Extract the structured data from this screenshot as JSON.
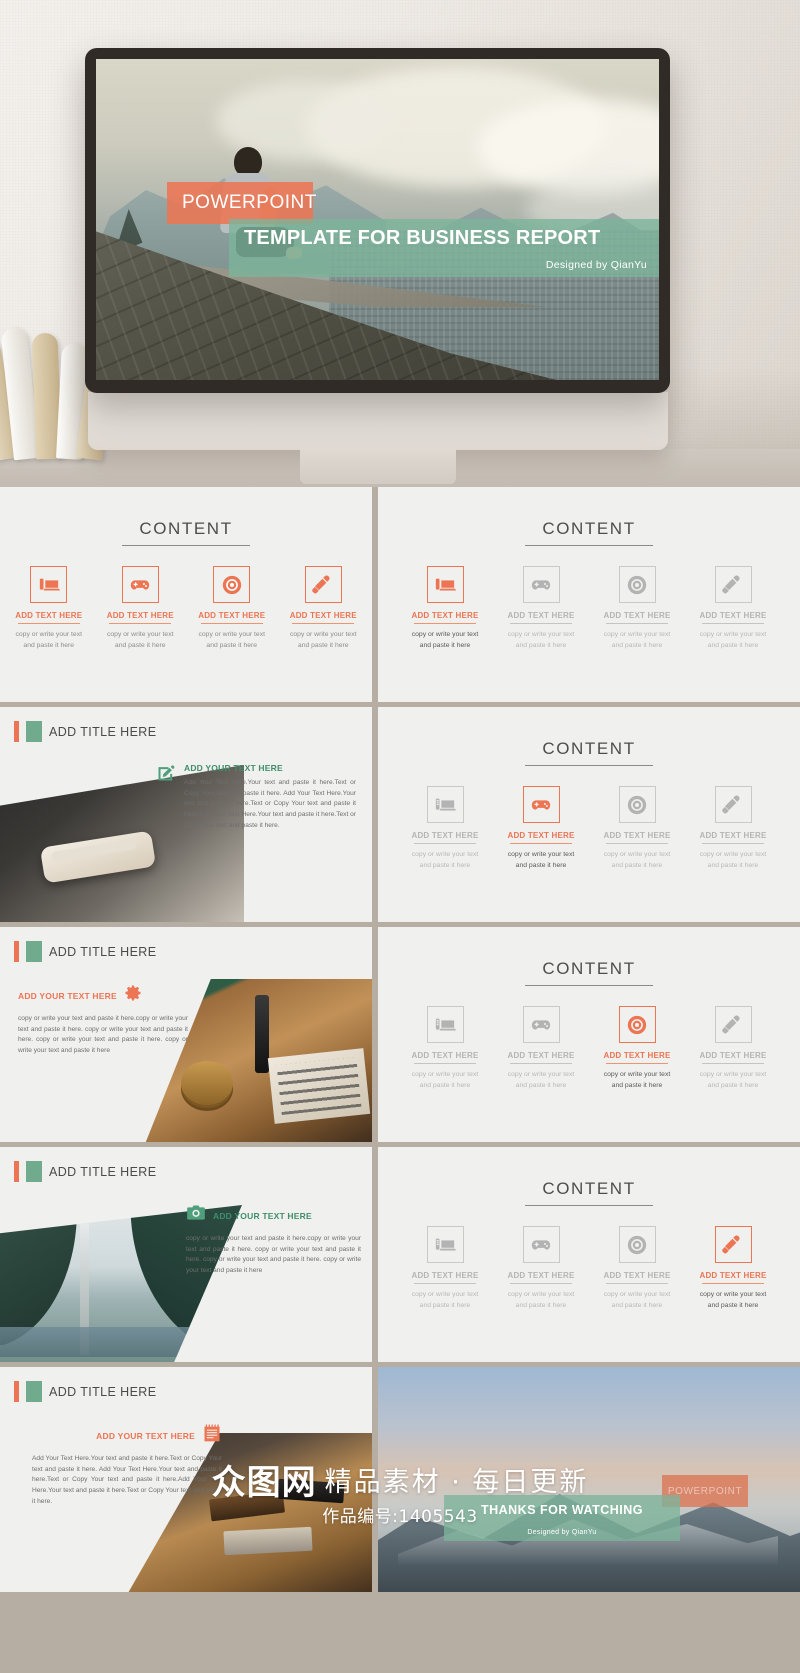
{
  "hero": {
    "badge_label": "POWERPOINT",
    "title": "TEMPLATE FOR BUSINESS REPORT",
    "subtitle": "Designed by QianYu"
  },
  "colors": {
    "orange": "#EC7553",
    "green": "#7CB49A",
    "green_dark": "#3F8F6B",
    "slide_bg": "#F0F0EF",
    "gutter": "#B6ADA3"
  },
  "content_slide": {
    "title": "CONTENT",
    "items": [
      {
        "icon": "desktop-computer-icon",
        "heading": "ADD TEXT HERE",
        "body": "copy or write your text and paste it here"
      },
      {
        "icon": "gamepad-icon",
        "heading": "ADD TEXT HERE",
        "body": "copy or write your text and paste it here"
      },
      {
        "icon": "compact-disc-icon",
        "heading": "ADD TEXT HERE",
        "body": "copy or write your text and paste it here"
      },
      {
        "icon": "eyedropper-icon",
        "heading": "ADD TEXT HERE",
        "body": "copy or write your text and paste it here"
      }
    ]
  },
  "slides": {
    "content_all_active": {
      "active_index": -1,
      "all_active": true
    },
    "content_active_0": {
      "active_index": 0
    },
    "content_active_1": {
      "active_index": 1
    },
    "content_active_2": {
      "active_index": 2
    },
    "content_active_3": {
      "active_index": 3
    },
    "title_slide_1": {
      "title": "ADD TITLE HERE",
      "icon": "pencil-edit-icon",
      "heading": "ADD YOUR TEXT HERE",
      "heading_color": "green",
      "body": "Add Your Text Here.Your text and paste it here.Text or Copy Your text and paste it here. Add Your Text Here.Your text and paste it here.Text or Copy Your text and paste it here.Add Your Text Here.Your text and paste it here.Text or Copy Your text and paste it here."
    },
    "title_slide_2": {
      "title": "ADD TITLE HERE",
      "icon": "gear-icon",
      "heading": "ADD YOUR TEXT HERE",
      "heading_color": "orange",
      "body": "copy or write your text and paste it here.copy or write your text and paste it here. copy or write your text and paste it here. copy or write your text and paste it here. copy or write your text and paste it here"
    },
    "title_slide_3": {
      "title": "ADD TITLE HERE",
      "icon": "camera-icon",
      "heading": "ADD YOUR TEXT HERE",
      "heading_color": "green",
      "body": "copy or write your text and paste it here.copy or write your text and paste it here. copy or write your text and paste it here. copy or write your text and paste it here. copy or write your text and paste it here"
    },
    "title_slide_4": {
      "title": "ADD TITLE HERE",
      "icon": "notepad-icon",
      "heading": "ADD YOUR TEXT HERE",
      "heading_color": "orange",
      "body": "Add Your Text Here.Your text and paste it here.Text or Copy Your text and paste it here. Add Your Text Here.Your text and paste it here.Text or Copy Your text and paste it here.Add Your Text Here.Your text and paste it here.Text or Copy Your text and paste it here."
    },
    "thanks_slide": {
      "badge_label": "POWERPOINT",
      "title": "THANKS FOR WATCHING",
      "subtitle": "Designed by QianYu"
    }
  },
  "watermark": {
    "logo": "众图网",
    "tagline": "精品素材 · 每日更新",
    "id_label": "作品编号:",
    "id_value": "1405543"
  }
}
